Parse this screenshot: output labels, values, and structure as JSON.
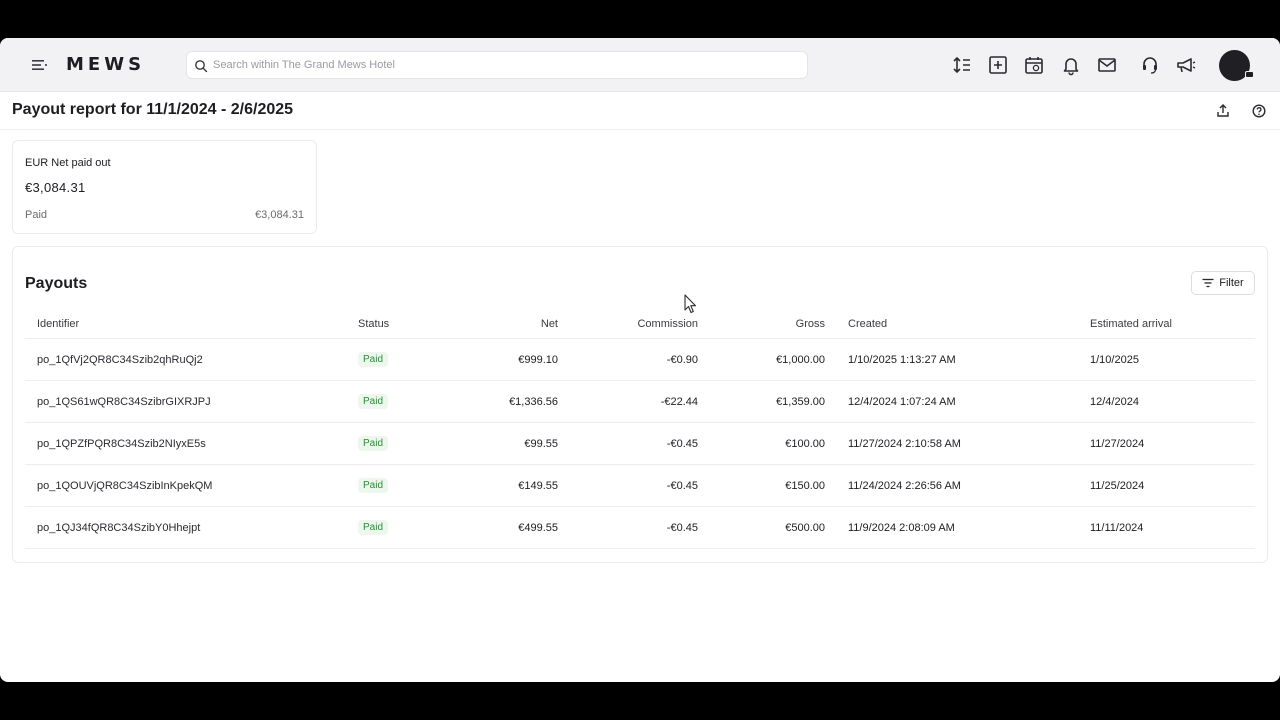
{
  "topbar": {
    "logo": "MEWS",
    "search_placeholder": "Search within The Grand Mews Hotel",
    "icons": [
      "sort-icon",
      "add-square-icon",
      "calendar-icon",
      "bell-icon",
      "mail-icon",
      "headset-icon",
      "megaphone-icon"
    ]
  },
  "page": {
    "title": "Payout report for 11/1/2024 - 2/6/2025"
  },
  "summary": {
    "label": "EUR Net paid out",
    "amount": "€3,084.31",
    "sub_label": "Paid",
    "sub_value": "€3,084.31"
  },
  "payouts": {
    "title": "Payouts",
    "filter_label": "Filter",
    "columns": {
      "identifier": "Identifier",
      "status": "Status",
      "net": "Net",
      "commission": "Commission",
      "gross": "Gross",
      "created": "Created",
      "arrival": "Estimated arrival"
    },
    "rows": [
      {
        "id": "po_1QfVj2QR8C34Szib2qhRuQj2",
        "status": "Paid",
        "net": "€999.10",
        "commission": "-€0.90",
        "gross": "€1,000.00",
        "created": "1/10/2025 1:13:27 AM",
        "arrival": "1/10/2025"
      },
      {
        "id": "po_1QS61wQR8C34SzibrGIXRJPJ",
        "status": "Paid",
        "net": "€1,336.56",
        "commission": "-€22.44",
        "gross": "€1,359.00",
        "created": "12/4/2024 1:07:24 AM",
        "arrival": "12/4/2024"
      },
      {
        "id": "po_1QPZfPQR8C34Szib2NIyxE5s",
        "status": "Paid",
        "net": "€99.55",
        "commission": "-€0.45",
        "gross": "€100.00",
        "created": "11/27/2024 2:10:58 AM",
        "arrival": "11/27/2024"
      },
      {
        "id": "po_1QOUVjQR8C34SzibInKpekQM",
        "status": "Paid",
        "net": "€149.55",
        "commission": "-€0.45",
        "gross": "€150.00",
        "created": "11/24/2024 2:26:56 AM",
        "arrival": "11/25/2024"
      },
      {
        "id": "po_1QJ34fQR8C34SzibY0Hhejpt",
        "status": "Paid",
        "net": "€499.55",
        "commission": "-€0.45",
        "gross": "€500.00",
        "created": "11/9/2024 2:08:09 AM",
        "arrival": "11/11/2024"
      }
    ]
  },
  "colors": {
    "accent_paid_text": "#2f8a3c",
    "accent_paid_bg": "#eef7ee",
    "topbar_bg": "#f2f2f4"
  }
}
